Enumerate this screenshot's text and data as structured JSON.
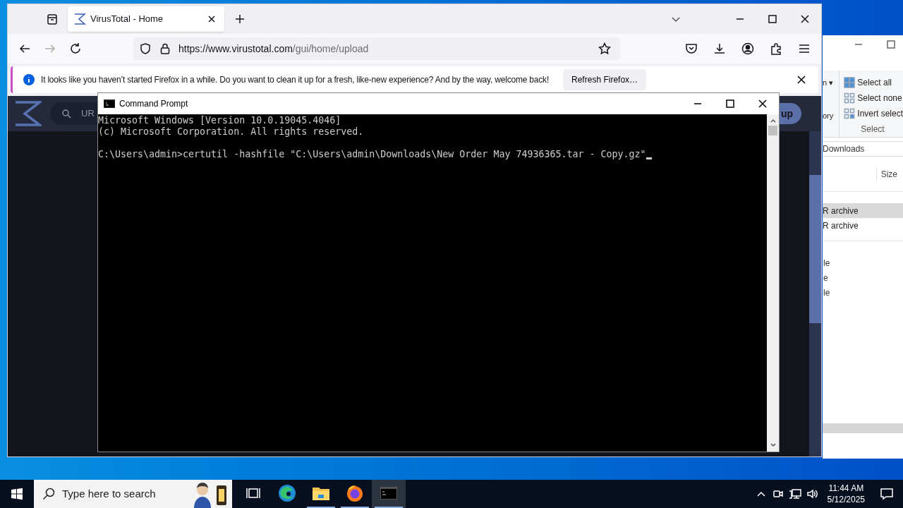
{
  "browser": {
    "tabs": [
      {
        "title": "VirusTotal - Home",
        "selected": true
      }
    ],
    "url": {
      "host": "https://www.virustotal.com",
      "path": "/gui/home/upload"
    },
    "notification": {
      "message": "It looks like you haven’t started Firefox in a while. Do you want to clean it up for a fresh, like-new experience? And by the way, welcome back!",
      "button": "Refresh Firefox…"
    },
    "page": {
      "search_placeholder": "UR",
      "button": "up"
    }
  },
  "cmd": {
    "title": "Command Prompt",
    "banner": [
      "Microsoft Windows [Version 10.0.19045.4046]",
      "(c) Microsoft Corporation. All rights reserved."
    ],
    "prompt": "C:\\Users\\admin>",
    "command": "certutil -hashfile \"C:\\Users\\admin\\Downloads\\New Order May 74936365.tar - Copy.gz\""
  },
  "explorer": {
    "ribbon_fragments": [
      "n ▾",
      "ory"
    ],
    "ribbon_items": [
      "Select all",
      "Select none",
      "Invert select"
    ],
    "ribbon_group": "Select",
    "address": "Downloads",
    "column": "Size",
    "rows": [
      {
        "text": "R archive",
        "selected": true
      },
      {
        "text": "R archive",
        "selected": false
      }
    ],
    "more_rows": [
      "le",
      "e",
      "le"
    ]
  },
  "taskbar": {
    "search_placeholder": "Type here to search",
    "apps": [
      {
        "kind": "taskview",
        "running": false,
        "selected": false
      },
      {
        "kind": "edge",
        "running": false,
        "selected": false
      },
      {
        "kind": "files",
        "running": true,
        "selected": false
      },
      {
        "kind": "firefox",
        "running": true,
        "selected": false
      },
      {
        "kind": "terminal",
        "running": true,
        "selected": true
      }
    ],
    "time": "11:44 AM",
    "date": "5/12/2025"
  }
}
